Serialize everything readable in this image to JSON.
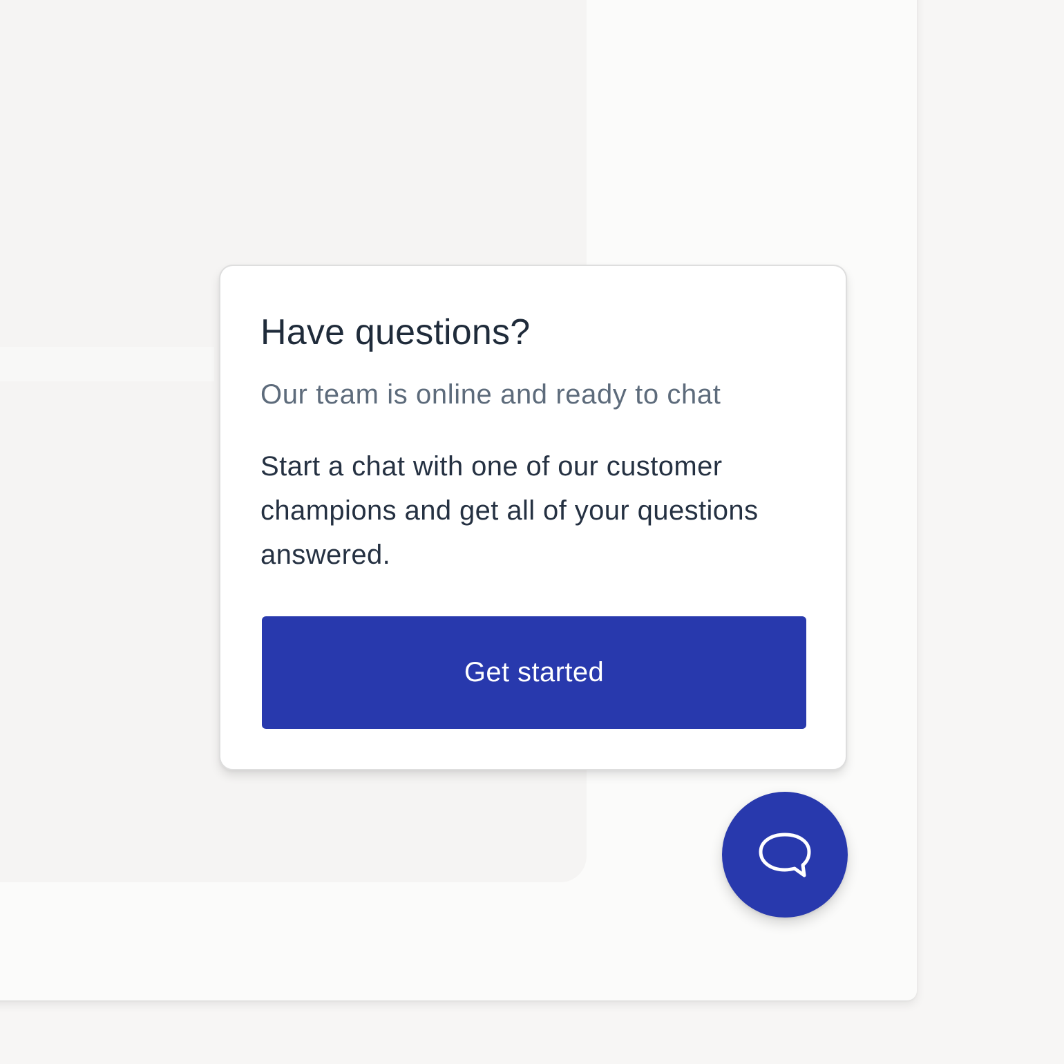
{
  "widget": {
    "title": "Have questions?",
    "subtitle": "Our team is online and ready to chat",
    "body": "Start a chat with one of our customer champions and get all of your questions answered.",
    "button_label": "Get started"
  },
  "launcher": {
    "icon": "chat-bubble-icon",
    "aria_label": "Open chat"
  },
  "colors": {
    "brand": "#2839ad",
    "title_text": "#1f2b3a",
    "subtitle_text": "#5d6b7b",
    "body_text": "#253142",
    "card_background": "#ffffff",
    "page_background": "#f7f6f5"
  }
}
